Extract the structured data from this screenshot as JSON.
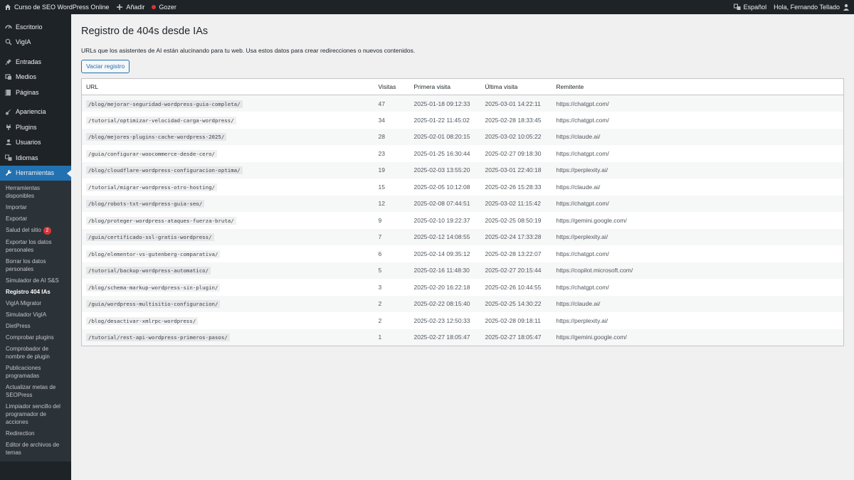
{
  "adminbar": {
    "site_name": "Curso de SEO WordPress Online",
    "add_new": "Añadir",
    "plugin_item": "Gozer",
    "language": "Español",
    "greeting": "Hola, Fernando Tellado"
  },
  "sidebar": {
    "items": [
      {
        "label": "Escritorio",
        "icon": "dashboard-icon"
      },
      {
        "label": "VigIA",
        "icon": "search-icon"
      },
      {
        "label": "Entradas",
        "icon": "pin-icon"
      },
      {
        "label": "Medios",
        "icon": "media-icon"
      },
      {
        "label": "Páginas",
        "icon": "pages-icon"
      },
      {
        "label": "Apariencia",
        "icon": "brush-icon"
      },
      {
        "label": "Plugins",
        "icon": "plugin-icon"
      },
      {
        "label": "Usuarios",
        "icon": "users-icon"
      },
      {
        "label": "Idiomas",
        "icon": "translation-icon"
      },
      {
        "label": "Herramientas",
        "icon": "wrench-icon"
      }
    ],
    "submenu": [
      "Herramientas disponibles",
      "Importar",
      "Exportar",
      "Salud del sitio",
      "Exportar los datos personales",
      "Borrar los datos personales",
      "Simulador de AI S&S",
      "Registro 404 IAs",
      "VigIA Migrator",
      "Simulador VigIA",
      "DietPress",
      "Comprobar plugins",
      "Comprobador de nombre de plugin",
      "Publicaciones programadas",
      "Actualizar metas de SEOPress",
      "Limpiador sencillo del programador de acciones",
      "Redirection",
      "Editor de archivos de temas"
    ],
    "site_health_badge": "2"
  },
  "main": {
    "title": "Registro de 404s desde IAs",
    "description": "URLs que los asistentes de AI están alucinando para tu web. Usa estos datos para crear redirecciones o nuevos contenidos.",
    "clear_button": "Vaciar registro",
    "columns": [
      "URL",
      "Visitas",
      "Primera visita",
      "Última visita",
      "Remitente"
    ],
    "rows": [
      [
        "/blog/mejorar-seguridad-wordpress-guia-completa/",
        "47",
        "2025-01-18 09:12:33",
        "2025-03-01 14:22:11",
        "https://chatgpt.com/"
      ],
      [
        "/tutorial/optimizar-velocidad-carga-wordpress/",
        "34",
        "2025-01-22 11:45:02",
        "2025-02-28 18:33:45",
        "https://chatgpt.com/"
      ],
      [
        "/blog/mejores-plugins-cache-wordpress-2025/",
        "28",
        "2025-02-01 08:20:15",
        "2025-03-02 10:05:22",
        "https://claude.ai/"
      ],
      [
        "/guia/configurar-woocommerce-desde-cero/",
        "23",
        "2025-01-25 16:30:44",
        "2025-02-27 09:18:30",
        "https://chatgpt.com/"
      ],
      [
        "/blog/cloudflare-wordpress-configuracion-optima/",
        "19",
        "2025-02-03 13:55:20",
        "2025-03-01 22:40:18",
        "https://perplexity.ai/"
      ],
      [
        "/tutorial/migrar-wordpress-otro-hosting/",
        "15",
        "2025-02-05 10:12:08",
        "2025-02-26 15:28:33",
        "https://claude.ai/"
      ],
      [
        "/blog/robots-txt-wordpress-guia-seo/",
        "12",
        "2025-02-08 07:44:51",
        "2025-03-02 11:15:42",
        "https://chatgpt.com/"
      ],
      [
        "/blog/proteger-wordpress-ataques-fuerza-bruta/",
        "9",
        "2025-02-10 19:22:37",
        "2025-02-25 08:50:19",
        "https://gemini.google.com/"
      ],
      [
        "/guia/certificado-ssl-gratis-wordpress/",
        "7",
        "2025-02-12 14:08:55",
        "2025-02-24 17:33:28",
        "https://perplexity.ai/"
      ],
      [
        "/blog/elementor-vs-gutenberg-comparativa/",
        "6",
        "2025-02-14 09:35:12",
        "2025-02-28 13:22:07",
        "https://chatgpt.com/"
      ],
      [
        "/tutorial/backup-wordpress-automatico/",
        "5",
        "2025-02-16 11:48:30",
        "2025-02-27 20:15:44",
        "https://copilot.microsoft.com/"
      ],
      [
        "/blog/schema-markup-wordpress-sin-plugin/",
        "3",
        "2025-02-20 16:22:18",
        "2025-02-26 10:44:55",
        "https://chatgpt.com/"
      ],
      [
        "/guia/wordpress-multisitio-configuracion/",
        "2",
        "2025-02-22 08:15:40",
        "2025-02-25 14:30:22",
        "https://claude.ai/"
      ],
      [
        "/blog/desactivar-xmlrpc-wordpress/",
        "2",
        "2025-02-23 12:50:33",
        "2025-02-28 09:18:11",
        "https://perplexity.ai/"
      ],
      [
        "/tutorial/rest-api-wordpress-primeros-pasos/",
        "1",
        "2025-02-27 18:05:47",
        "2025-02-27 18:05:47",
        "https://gemini.google.com/"
      ]
    ]
  },
  "colors": {
    "adminbar_bg": "#1d2327",
    "accent": "#2271b1",
    "badge": "#d63638"
  }
}
